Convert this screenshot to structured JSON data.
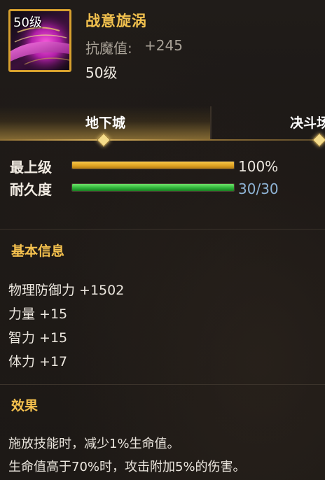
{
  "item": {
    "level_badge": "50级",
    "name": "战意旋涡",
    "stat_label": "抗魔值:",
    "stat_value": "+245",
    "required_level": "50级",
    "icon": "purple-vortex-item-icon"
  },
  "tabs": [
    {
      "label": "地下城",
      "active": true
    },
    {
      "label": "决斗场",
      "active": false
    }
  ],
  "bars": {
    "upgrade": {
      "label": "最上级",
      "value_text": "100%",
      "fill": 1.0,
      "color": "#e0a423"
    },
    "durability": {
      "label": "耐久度",
      "value_text": "30/30",
      "fill": 1.0,
      "color": "#2fb53a"
    }
  },
  "basic_info": {
    "title": "基本信息",
    "attributes": [
      "物理防御力 +1502",
      "力量 +15",
      "智力 +15",
      "体力 +17"
    ]
  },
  "effects": {
    "title": "效果",
    "lines": [
      "施放技能时，减少1%生命值。",
      "生命值高于70%时，攻击附加5%的伤害。"
    ]
  },
  "colors": {
    "accent_gold": "#f2c14e",
    "muted_text": "#a8a196",
    "durability_text": "#8fb4d6"
  }
}
